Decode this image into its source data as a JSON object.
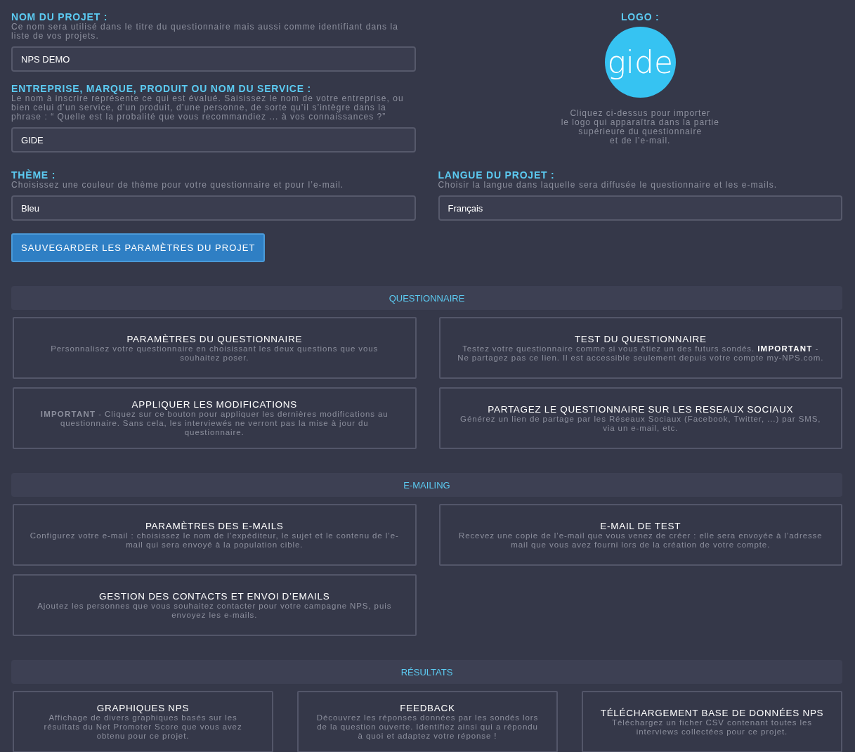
{
  "fields": [
    {
      "label": "NOM DU PROJET :",
      "help": "Ce nom sera utilisé dans le titre du questionnaire mais aussi comme identifiant dans la liste de vos projets.",
      "value": "NPS DEMO"
    },
    {
      "label": "ENTREPRISE, MARQUE, PRODUIT OU NOM DU SERVICE :",
      "help": "Le nom à inscrire représente ce qui est évalué. Saisissez le nom de votre entreprise, ou bien celui d’un service, d’un produit, d’une personne, de sorte qu’il s’intègre dans la phrase : “ Quelle est la probalité que vous recommandiez ... à vos connaissances ?”",
      "value": "GIDE"
    }
  ],
  "logo": {
    "label": "LOGO :",
    "text": "gide",
    "help": [
      "Cliquez ci-dessus pour importer",
      "le logo qui apparaîtra dans la partie",
      "supérieure du questionnaire",
      "et de l’e-mail."
    ]
  },
  "theme": {
    "label": "THÈME :",
    "help": "Choisissez une couleur de thème pour votre questionnaire et pour l’e-mail.",
    "value": "Bleu"
  },
  "language": {
    "label": "LANGUE DU PROJET :",
    "help": "Choisir la langue dans laquelle sera diffusée le questionnaire et les e-mails.",
    "value": "Français"
  },
  "save_button": "SAUVEGARDER LES PARAMÈTRES DU PROJET",
  "sections": [
    {
      "title": "QUESTIONNAIRE",
      "cards": [
        {
          "title": "PARAMÈTRES DU QUESTIONNAIRE",
          "text": "Personnalisez votre questionnaire en choisissant les deux questions que vous souhaitez poser."
        },
        {
          "title": "TEST DU QUESTIONNAIRE",
          "text": "Testez votre questionnaire comme si vous êtiez un des futurs sondés. **IMPORTANT** - Ne partagez pas ce lien. Il est accessible seulement depuis votre compte my-NPS.com.",
          "bright_emphasis": true
        },
        {
          "title": "APPLIQUER LES MODIFICATIONS",
          "text": "**IMPORTANT** - Cliquez sur ce bouton pour appliquer les dernières modifications au questionnaire. Sans cela, les interviewés ne verront pas la mise à jour du questionnaire.",
          "bright_emphasis": false
        },
        {
          "title": "PARTAGEZ LE QUESTIONNAIRE SUR LES RESEAUX SOCIAUX",
          "text": "Générez un lien de partage par les Réseaux Sociaux (Facebook, Twitter, ...) par SMS, via un e-mail, etc."
        }
      ]
    },
    {
      "title": "E-MAILING",
      "cards": [
        {
          "title": "PARAMÈTRES DES E-MAILS",
          "text": "Configurez votre e-mail : choisissez le nom de l’expéditeur, le sujet et le contenu de l’e-mail qui sera envoyé à la population cible."
        },
        {
          "title": "E-MAIL DE TEST",
          "text": "Recevez une copie de l’e-mail que vous venez de créer : elle sera envoyée à l’adresse mail que vous avez fourni lors de la création de votre compte."
        },
        {
          "title": "GESTION DES CONTACTS ET ENVOI D’EMAILS",
          "text": "Ajoutez les personnes que vous souhaitez contacter pour votre campagne NPS, puis envoyez les e-mails."
        }
      ]
    },
    {
      "title": "RÉSULTATS",
      "cards": [
        {
          "title": "GRAPHIQUES NPS",
          "text": "Affichage de divers graphiques basés sur les résultats du Net Promoter Score que vous avez obtenu pour ce projet."
        },
        {
          "title": "FEEDBACK",
          "text": "Découvrez les réponses données par les sondés lors de la question ouverte. Identifiez ainsi qui a répondu à quoi et adaptez votre réponse !"
        },
        {
          "title": "TÉLÉCHARGEMENT BASE DE DONNÉES NPS",
          "text": "Téléchargez un ficher CSV contenant toutes les interviews collectées pour ce projet."
        }
      ]
    }
  ]
}
